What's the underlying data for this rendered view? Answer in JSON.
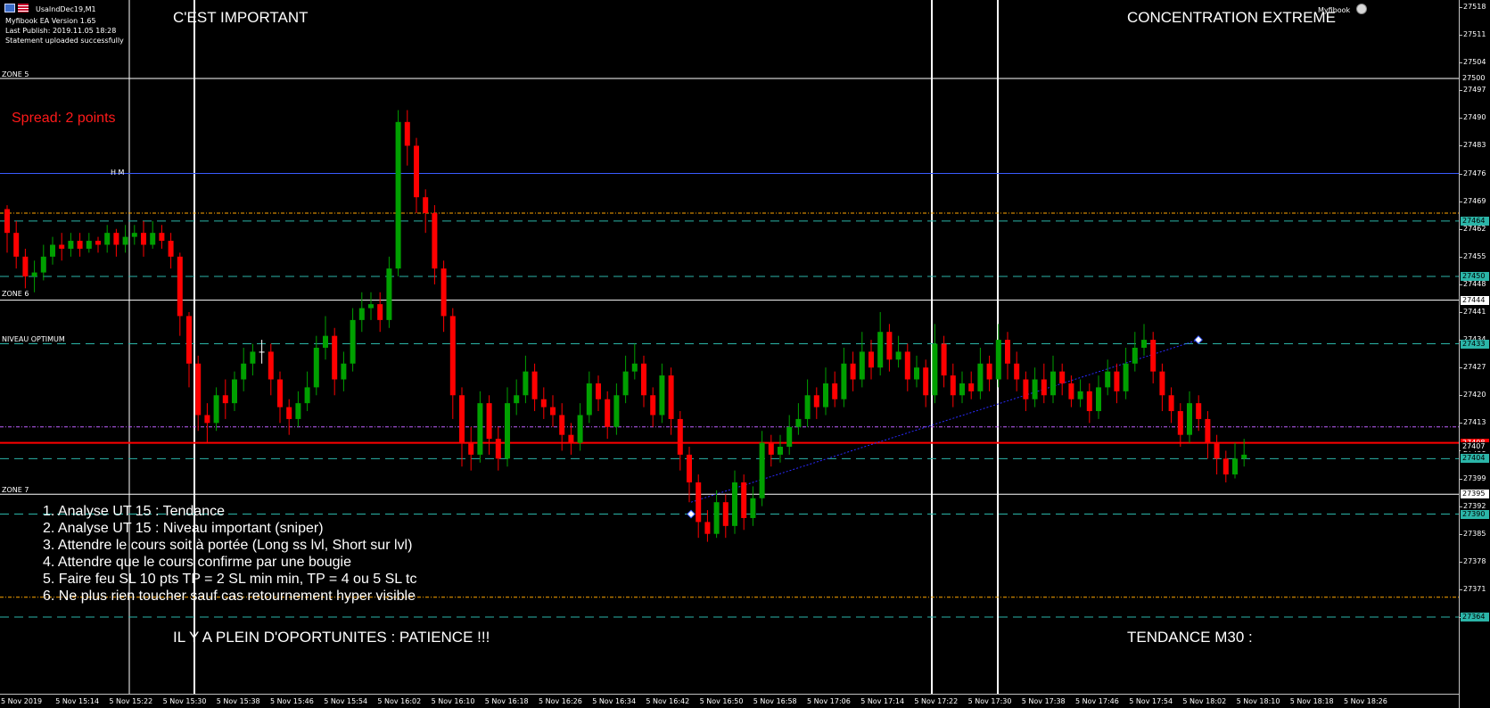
{
  "header": {
    "symbol_title": "UsaIndDec19,M1",
    "info_lines": [
      "Myfibook EA Version 1.65",
      "Last Publish: 2019.11.05 18:28",
      "Statement uploaded successfully"
    ],
    "brand": "Myfibook"
  },
  "labels": {
    "top_left": "C'EST IMPORTANT",
    "top_right": "CONCENTRATION EXTREME",
    "bottom_left": "IL Y A PLEIN D'OPORTUNITES : PATIENCE !!!",
    "bottom_right": "TENDANCE M30 :",
    "spread": "Spread: 2 points"
  },
  "zones": {
    "zone5": "ZONE 5",
    "hm": "H M",
    "zone6": "ZONE 6",
    "optimum": "NIVEAU OPTIMUM",
    "zone7": "ZONE 7"
  },
  "steps": [
    "1. Analyse UT 15 : Tendance",
    "2. Analyse UT 15 : Niveau important (sniper)",
    "3. Attendre le cours soit à portée (Long ss lvl, Short sur lvl)",
    "4. Attendre que le cours confirme par une bougie",
    "5. Faire feu SL 10 pts TP = 2 SL min min, TP = 4 ou 5 SL tc",
    "6. Ne plus rien toucher sauf cas retournement hyper visible"
  ],
  "price_axis": {
    "ticks": [
      "27518",
      "27511",
      "27504",
      "27497",
      "27490",
      "27483",
      "27476",
      "27469",
      "27462",
      "27455",
      "27448",
      "27441",
      "27434",
      "27427",
      "27420",
      "27413",
      "27406",
      "27399",
      "27392",
      "27385",
      "27378",
      "27371",
      "27364"
    ],
    "tags": [
      {
        "label": "27500",
        "price": 27500,
        "color": "#ffffff",
        "bg": "#000000"
      },
      {
        "label": "27464",
        "price": 27464,
        "color": "#000000",
        "bg": "#2bb5a8"
      },
      {
        "label": "27450",
        "price": 27450,
        "color": "#000000",
        "bg": "#2bb5a8"
      },
      {
        "label": "27444",
        "price": 27444,
        "color": "#000000",
        "bg": "#ffffff"
      },
      {
        "label": "27433",
        "price": 27433,
        "color": "#000000",
        "bg": "#2bb5a8"
      },
      {
        "label": "27408",
        "price": 27408,
        "color": "#ffffff",
        "bg": "#ff0000"
      },
      {
        "label": "27407",
        "price": 27407,
        "color": "#ffffff",
        "bg": "#000000"
      },
      {
        "label": "27404",
        "price": 27404,
        "color": "#000000",
        "bg": "#2bb5a8"
      },
      {
        "label": "27395",
        "price": 27395,
        "color": "#000000",
        "bg": "#ffffff"
      },
      {
        "label": "27390",
        "price": 27390,
        "color": "#000000",
        "bg": "#2bb5a8"
      },
      {
        "label": "27364",
        "price": 27364,
        "color": "#000000",
        "bg": "#2bb5a8"
      }
    ]
  },
  "time_axis": {
    "ticks": [
      "5 Nov 2019",
      "5 Nov 15:14",
      "5 Nov 15:22",
      "5 Nov 15:30",
      "5 Nov 15:38",
      "5 Nov 15:46",
      "5 Nov 15:54",
      "5 Nov 16:02",
      "5 Nov 16:10",
      "5 Nov 16:18",
      "5 Nov 16:26",
      "5 Nov 16:34",
      "5 Nov 16:42",
      "5 Nov 16:50",
      "5 Nov 16:58",
      "5 Nov 17:06",
      "5 Nov 17:14",
      "5 Nov 17:22",
      "5 Nov 17:30",
      "5 Nov 17:38",
      "5 Nov 17:46",
      "5 Nov 17:54",
      "5 Nov 18:02",
      "5 Nov 18:10",
      "5 Nov 18:18",
      "5 Nov 18:26"
    ]
  },
  "colors": {
    "bull": "#00a000",
    "bear": "#ff0000",
    "doji": "#ffffff",
    "hm_line": "#3a5bff",
    "teal": "#2bb5a8",
    "orange": "#ffa500",
    "violet": "#c060ff",
    "red_line": "#ff0000"
  },
  "chart_data": {
    "type": "candlestick",
    "symbol": "UsaIndDec19",
    "timeframe": "M1",
    "ylim": [
      27364,
      27518
    ],
    "levels": [
      {
        "name": "ZONE 5",
        "price": 27500
      },
      {
        "name": "H M",
        "price": 27476
      },
      {
        "name": "ZONE 6",
        "price": 27444
      },
      {
        "name": "NIVEAU OPTIMUM",
        "price": 27433
      },
      {
        "name": "ZONE 7",
        "price": 27395
      }
    ],
    "candles": [
      [
        27467,
        27461,
        27468,
        27456
      ],
      [
        27461,
        27455,
        27464,
        27452
      ],
      [
        27455,
        27450,
        27457,
        27447
      ],
      [
        27450,
        27451,
        27454,
        27446
      ],
      [
        27451,
        27455,
        27458,
        27449
      ],
      [
        27455,
        27458,
        27460,
        27453
      ],
      [
        27458,
        27457,
        27461,
        27454
      ],
      [
        27457,
        27459,
        27461,
        27455
      ],
      [
        27459,
        27457,
        27461,
        27455
      ],
      [
        27457,
        27459,
        27461,
        27456
      ],
      [
        27459,
        27458,
        27460,
        27456
      ],
      [
        27458,
        27461,
        27463,
        27456
      ],
      [
        27461,
        27458,
        27462,
        27455
      ],
      [
        27458,
        27460,
        27463,
        27456
      ],
      [
        27460,
        27461,
        27463,
        27458
      ],
      [
        27461,
        27458,
        27464,
        27455
      ],
      [
        27458,
        27461,
        27464,
        27457
      ],
      [
        27461,
        27459,
        27463,
        27457
      ],
      [
        27459,
        27455,
        27461,
        27452
      ],
      [
        27455,
        27440,
        27456,
        27435
      ],
      [
        27440,
        27428,
        27441,
        27422
      ],
      [
        27428,
        27415,
        27430,
        27411
      ],
      [
        27415,
        27413,
        27418,
        27408
      ],
      [
        27413,
        27420,
        27422,
        27411
      ],
      [
        27420,
        27418,
        27424,
        27414
      ],
      [
        27418,
        27424,
        27426,
        27416
      ],
      [
        27424,
        27428,
        27432,
        27421
      ],
      [
        27428,
        27431,
        27433,
        27425
      ],
      [
        27431,
        27431,
        27434,
        27428
      ],
      [
        27431,
        27424,
        27433,
        27420
      ],
      [
        27424,
        27417,
        27426,
        27413
      ],
      [
        27417,
        27414,
        27419,
        27410
      ],
      [
        27414,
        27418,
        27421,
        27412
      ],
      [
        27418,
        27422,
        27426,
        27416
      ],
      [
        27422,
        27432,
        27435,
        27420
      ],
      [
        27432,
        27435,
        27440,
        27429
      ],
      [
        27435,
        27424,
        27437,
        27420
      ],
      [
        27424,
        27428,
        27431,
        27421
      ],
      [
        27428,
        27439,
        27442,
        27426
      ],
      [
        27439,
        27442,
        27446,
        27436
      ],
      [
        27442,
        27443,
        27446,
        27439
      ],
      [
        27443,
        27439,
        27446,
        27436
      ],
      [
        27439,
        27452,
        27455,
        27437
      ],
      [
        27452,
        27489,
        27492,
        27450
      ],
      [
        27489,
        27483,
        27492,
        27478
      ],
      [
        27483,
        27470,
        27485,
        27466
      ],
      [
        27470,
        27466,
        27472,
        27461
      ],
      [
        27466,
        27452,
        27468,
        27448
      ],
      [
        27452,
        27440,
        27454,
        27436
      ],
      [
        27440,
        27420,
        27442,
        27414
      ],
      [
        27420,
        27408,
        27422,
        27402
      ],
      [
        27408,
        27405,
        27412,
        27401
      ],
      [
        27405,
        27418,
        27421,
        27403
      ],
      [
        27418,
        27409,
        27420,
        27405
      ],
      [
        27409,
        27404,
        27412,
        27401
      ],
      [
        27404,
        27418,
        27422,
        27402
      ],
      [
        27418,
        27420,
        27424,
        27415
      ],
      [
        27420,
        27426,
        27430,
        27418
      ],
      [
        27426,
        27419,
        27428,
        27416
      ],
      [
        27419,
        27417,
        27422,
        27414
      ],
      [
        27417,
        27415,
        27420,
        27412
      ],
      [
        27415,
        27410,
        27418,
        27406
      ],
      [
        27410,
        27408,
        27413,
        27405
      ],
      [
        27408,
        27415,
        27418,
        27406
      ],
      [
        27415,
        27423,
        27426,
        27413
      ],
      [
        27423,
        27419,
        27425,
        27416
      ],
      [
        27419,
        27412,
        27421,
        27409
      ],
      [
        27412,
        27420,
        27423,
        27410
      ],
      [
        27420,
        27426,
        27430,
        27418
      ],
      [
        27426,
        27428,
        27433,
        27424
      ],
      [
        27428,
        27420,
        27430,
        27417
      ],
      [
        27420,
        27415,
        27422,
        27412
      ],
      [
        27415,
        27425,
        27428,
        27413
      ],
      [
        27425,
        27414,
        27427,
        27410
      ],
      [
        27414,
        27405,
        27416,
        27401
      ],
      [
        27405,
        27398,
        27407,
        27393
      ],
      [
        27398,
        27388,
        27400,
        27384
      ],
      [
        27388,
        27385,
        27391,
        27383
      ],
      [
        27385,
        27393,
        27396,
        27384
      ],
      [
        27393,
        27387,
        27395,
        27384
      ],
      [
        27387,
        27398,
        27401,
        27385
      ],
      [
        27398,
        27389,
        27400,
        27386
      ],
      [
        27389,
        27394,
        27397,
        27387
      ],
      [
        27394,
        27408,
        27411,
        27392
      ],
      [
        27408,
        27405,
        27410,
        27402
      ],
      [
        27405,
        27407,
        27410,
        27403
      ],
      [
        27407,
        27412,
        27415,
        27405
      ],
      [
        27412,
        27414,
        27418,
        27410
      ],
      [
        27414,
        27420,
        27424,
        27412
      ],
      [
        27420,
        27417,
        27422,
        27414
      ],
      [
        27417,
        27423,
        27427,
        27415
      ],
      [
        27423,
        27419,
        27426,
        27417
      ],
      [
        27419,
        27428,
        27432,
        27417
      ],
      [
        27428,
        27424,
        27431,
        27421
      ],
      [
        27424,
        27431,
        27436,
        27422
      ],
      [
        27431,
        27427,
        27434,
        27424
      ],
      [
        27427,
        27436,
        27441,
        27425
      ],
      [
        27436,
        27429,
        27438,
        27426
      ],
      [
        27429,
        27431,
        27435,
        27427
      ],
      [
        27431,
        27424,
        27433,
        27421
      ],
      [
        27424,
        27427,
        27430,
        27422
      ],
      [
        27427,
        27420,
        27429,
        27417
      ],
      [
        27420,
        27433,
        27438,
        27418
      ],
      [
        27433,
        27425,
        27435,
        27422
      ],
      [
        27425,
        27420,
        27428,
        27417
      ],
      [
        27420,
        27423,
        27426,
        27418
      ],
      [
        27423,
        27421,
        27426,
        27419
      ],
      [
        27421,
        27428,
        27432,
        27419
      ],
      [
        27428,
        27424,
        27430,
        27421
      ],
      [
        27424,
        27434,
        27438,
        27422
      ],
      [
        27434,
        27428,
        27436,
        27424
      ],
      [
        27428,
        27424,
        27431,
        27421
      ],
      [
        27424,
        27419,
        27426,
        27416
      ],
      [
        27419,
        27424,
        27427,
        27417
      ],
      [
        27424,
        27420,
        27428,
        27418
      ],
      [
        27420,
        27426,
        27430,
        27418
      ],
      [
        27426,
        27423,
        27428,
        27420
      ],
      [
        27423,
        27419,
        27425,
        27417
      ],
      [
        27419,
        27421,
        27424,
        27417
      ],
      [
        27421,
        27416,
        27423,
        27413
      ],
      [
        27416,
        27422,
        27425,
        27414
      ],
      [
        27422,
        27426,
        27429,
        27420
      ],
      [
        27426,
        27421,
        27428,
        27418
      ],
      [
        27421,
        27428,
        27432,
        27419
      ],
      [
        27428,
        27432,
        27436,
        27426
      ],
      [
        27432,
        27434,
        27438,
        27430
      ],
      [
        27434,
        27426,
        27436,
        27423
      ],
      [
        27426,
        27420,
        27428,
        27416
      ],
      [
        27420,
        27416,
        27422,
        27413
      ],
      [
        27416,
        27410,
        27418,
        27407
      ],
      [
        27410,
        27418,
        27421,
        27408
      ],
      [
        27418,
        27414,
        27420,
        27411
      ],
      [
        27414,
        27408,
        27416,
        27404
      ],
      [
        27408,
        27404,
        27410,
        27400
      ],
      [
        27404,
        27400,
        27406,
        27398
      ],
      [
        27400,
        27404,
        27408,
        27399
      ],
      [
        27404,
        27405,
        27409,
        27402
      ]
    ]
  }
}
